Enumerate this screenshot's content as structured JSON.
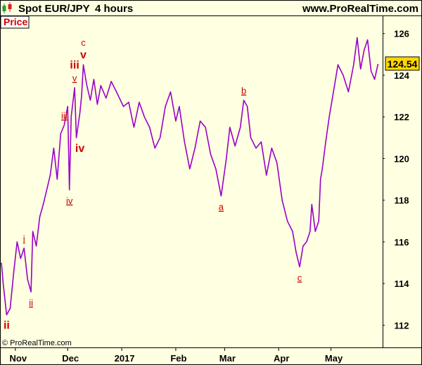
{
  "header": {
    "title": "Spot EUR/JPY",
    "timeframe": "4 hours",
    "site": "www.ProRealTime.com"
  },
  "price_tab": "Price",
  "copyright": "© ProRealTime.com",
  "last_price_label": "124.54",
  "colors": {
    "background": "#ffffe1",
    "line": "#9900cc",
    "wave_label": "#cc0000",
    "last_price_box": "#ffd700",
    "icon_green": "#2e9b2e",
    "icon_red": "#d82020"
  },
  "icons": [
    "green-candle-icon",
    "red-candle-icon"
  ],
  "chart_data": {
    "type": "line",
    "title": "Spot EUR/JPY",
    "xlabel": "",
    "ylabel": "",
    "ylim": [
      111,
      126.8
    ],
    "y_ticks": [
      112,
      114,
      116,
      118,
      120,
      122,
      124,
      126
    ],
    "x_ticks": [
      "Nov",
      "Dec",
      "2017",
      "Feb",
      "Mar",
      "Apr",
      "May"
    ],
    "x_tick_dates": [
      "2016-11-01",
      "2016-12-01",
      "2017-01-01",
      "2017-02-01",
      "2017-03-01",
      "2017-04-01",
      "2017-05-01"
    ],
    "xlim": [
      "2016-10-24",
      "2017-05-29"
    ],
    "last_price": 124.54,
    "grid": false,
    "series": [
      {
        "x": [
          "2016-10-24",
          "2016-10-25",
          "2016-10-27",
          "2016-10-29",
          "2016-10-31",
          "2016-11-02",
          "2016-11-04",
          "2016-11-06",
          "2016-11-08",
          "2016-11-10",
          "2016-11-11",
          "2016-11-13",
          "2016-11-15",
          "2016-11-17",
          "2016-11-19",
          "2016-11-21",
          "2016-11-23",
          "2016-11-25",
          "2016-11-27",
          "2016-11-29",
          "2016-12-01",
          "2016-12-02",
          "2016-12-03",
          "2016-12-05",
          "2016-12-06",
          "2016-12-08",
          "2016-12-09",
          "2016-12-10",
          "2016-12-12",
          "2016-12-14",
          "2016-12-16",
          "2016-12-18",
          "2016-12-20",
          "2016-12-23",
          "2016-12-26",
          "2016-12-29",
          "2017-01-02",
          "2017-01-05",
          "2017-01-08",
          "2017-01-11",
          "2017-01-14",
          "2017-01-17",
          "2017-01-20",
          "2017-01-23",
          "2017-01-26",
          "2017-01-29",
          "2017-02-01",
          "2017-02-03",
          "2017-02-06",
          "2017-02-09",
          "2017-02-12",
          "2017-02-15",
          "2017-02-18",
          "2017-02-21",
          "2017-02-24",
          "2017-02-27",
          "2017-03-02",
          "2017-03-04",
          "2017-03-07",
          "2017-03-10",
          "2017-03-12",
          "2017-03-14",
          "2017-03-16",
          "2017-03-19",
          "2017-03-22",
          "2017-03-25",
          "2017-03-28",
          "2017-03-31",
          "2017-04-03",
          "2017-04-06",
          "2017-04-09",
          "2017-04-11",
          "2017-04-13",
          "2017-04-15",
          "2017-04-17",
          "2017-04-19",
          "2017-04-20",
          "2017-04-22",
          "2017-04-24",
          "2017-04-25",
          "2017-04-26",
          "2017-04-28",
          "2017-04-30",
          "2017-05-02",
          "2017-05-05",
          "2017-05-08",
          "2017-05-11",
          "2017-05-14",
          "2017-05-16",
          "2017-05-18",
          "2017-05-20",
          "2017-05-22",
          "2017-05-24",
          "2017-05-26",
          "2017-05-28"
        ],
        "values": [
          115.0,
          114.0,
          112.5,
          112.8,
          114.5,
          116.0,
          115.2,
          115.7,
          114.2,
          113.6,
          116.5,
          115.8,
          117.2,
          117.8,
          118.5,
          119.2,
          120.5,
          119.0,
          121.2,
          121.6,
          122.5,
          118.5,
          122.0,
          123.4,
          121.0,
          122.2,
          123.0,
          124.5,
          123.5,
          122.8,
          123.8,
          122.6,
          123.5,
          122.9,
          123.7,
          123.2,
          122.5,
          122.7,
          121.5,
          122.7,
          122.0,
          121.5,
          120.5,
          121.0,
          122.5,
          123.2,
          121.8,
          122.5,
          120.8,
          119.5,
          120.5,
          121.8,
          121.5,
          120.2,
          119.5,
          118.2,
          120.0,
          121.5,
          120.6,
          121.5,
          122.8,
          122.5,
          121.0,
          120.5,
          120.8,
          119.2,
          120.5,
          119.8,
          118.0,
          117.0,
          116.5,
          115.5,
          114.8,
          115.8,
          116.0,
          116.5,
          117.8,
          116.5,
          117.0,
          119.0,
          119.5,
          120.8,
          122.0,
          123.0,
          124.5,
          124.0,
          123.2,
          124.5,
          125.8,
          124.3,
          125.2,
          125.7,
          124.2,
          123.8,
          124.54
        ]
      }
    ],
    "annotations": [
      {
        "label": "ii",
        "x": "2016-10-27",
        "y": 112.5,
        "style": "bold",
        "position": "below"
      },
      {
        "label": "i",
        "x": "2016-11-06",
        "y": 115.7,
        "style": "underlined",
        "position": "above"
      },
      {
        "label": "ii",
        "x": "2016-11-10",
        "y": 113.6,
        "style": "underlined",
        "position": "below"
      },
      {
        "label": "iii",
        "x": "2016-11-29",
        "y": 121.6,
        "style": "underlined",
        "position": "above"
      },
      {
        "label": "iv",
        "x": "2016-12-02",
        "y": 118.5,
        "style": "underlined",
        "position": "below"
      },
      {
        "label": "iii",
        "x": "2016-12-05",
        "y": 123.4,
        "style": "bold",
        "position": "above-high"
      },
      {
        "label": "v",
        "x": "2016-12-05",
        "y": 123.4,
        "style": "underlined",
        "position": "above"
      },
      {
        "label": "iv",
        "x": "2016-12-08",
        "y": 121.0,
        "style": "bold",
        "position": "below"
      },
      {
        "label": "c",
        "x": "2016-12-10",
        "y": 124.5,
        "style": "normal",
        "position": "above-high"
      },
      {
        "label": "v",
        "x": "2016-12-10",
        "y": 124.5,
        "style": "bold",
        "position": "above"
      },
      {
        "label": "a",
        "x": "2017-02-27",
        "y": 118.2,
        "style": "underlined",
        "position": "below"
      },
      {
        "label": "b",
        "x": "2017-03-12",
        "y": 122.8,
        "style": "underlined",
        "position": "above"
      },
      {
        "label": "c",
        "x": "2017-04-13",
        "y": 114.8,
        "style": "underlined",
        "position": "below"
      }
    ]
  }
}
